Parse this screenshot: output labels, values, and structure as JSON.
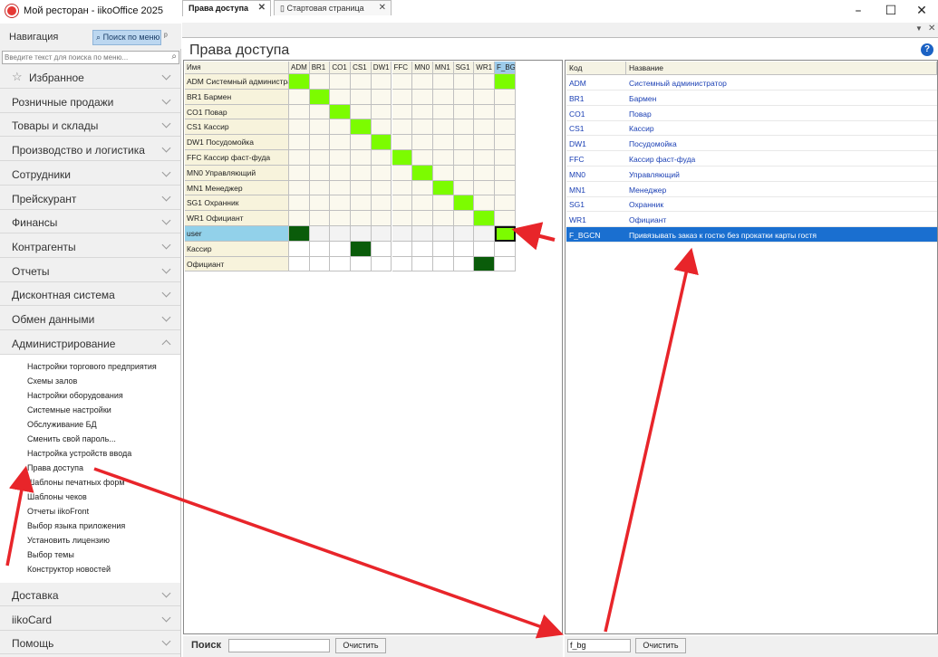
{
  "window": {
    "title": "Мой ресторан - iikoOffice 2025",
    "minimize": "–",
    "maximize": "☐",
    "close": "✕"
  },
  "nav": {
    "title": "Навигация",
    "search_button": "Поиск по меню",
    "search_placeholder": "Введите текст для поиска по меню...",
    "favorites": "Избранное",
    "sections_top": [
      "Розничные продажи",
      "Товары и склады",
      "Производство и логистика",
      "Сотрудники",
      "Прейскурант",
      "Финансы",
      "Контрагенты",
      "Отчеты",
      "Дисконтная система",
      "Обмен данными",
      "Администрирование"
    ],
    "admin_items": [
      "Настройки торгового предприятия",
      "Схемы залов",
      "Настройки оборудования",
      "Системные настройки",
      "Обслуживание БД",
      "Сменить свой пароль...",
      "Настройка устройств ввода",
      "Права доступа",
      "Шаблоны печатных форм",
      "Шаблоны чеков",
      "Отчеты iikoFront",
      "Выбор языка приложения",
      "Установить лицензию",
      "Выбор темы",
      "Конструктор новостей"
    ],
    "sections_bottom": [
      "Доставка",
      "iikoCard",
      "Помощь"
    ]
  },
  "tabs": [
    {
      "label": "Права доступа",
      "active": true
    },
    {
      "label": "Стартовая страница",
      "active": false
    }
  ],
  "page_title": "Права доступа",
  "matrix": {
    "name_header": "Имя",
    "columns": [
      "ADM",
      "BR1",
      "CO1",
      "CS1",
      "DW1",
      "FFC",
      "MN0",
      "MN1",
      "SG1",
      "WR1",
      "F_BGCN"
    ],
    "selected_column": 10,
    "rows": [
      {
        "name": "ADM Системный администратор",
        "on": [
          0,
          10
        ],
        "dark": []
      },
      {
        "name": "BR1 Бармен",
        "on": [
          1
        ],
        "dark": []
      },
      {
        "name": "CO1 Повар",
        "on": [
          2
        ],
        "dark": []
      },
      {
        "name": "CS1 Кассир",
        "on": [
          3
        ],
        "dark": []
      },
      {
        "name": "DW1 Посудомойка",
        "on": [
          4
        ],
        "dark": []
      },
      {
        "name": "FFC Кассир фаст-фуда",
        "on": [
          5
        ],
        "dark": []
      },
      {
        "name": "MN0 Управляющий",
        "on": [
          6
        ],
        "dark": []
      },
      {
        "name": "MN1 Менеджер",
        "on": [
          7
        ],
        "dark": []
      },
      {
        "name": "SG1 Охранник",
        "on": [
          8
        ],
        "dark": []
      },
      {
        "name": "WR1 Официант",
        "on": [
          9
        ],
        "dark": []
      },
      {
        "name": "user",
        "on": [
          10
        ],
        "dark": [
          0
        ],
        "selected": true,
        "focus_col": 10
      },
      {
        "name": "Кассир",
        "on": [],
        "dark": [
          3
        ]
      },
      {
        "name": "Официант",
        "on": [],
        "dark": [
          9
        ]
      }
    ],
    "on_color": "#7cfc00",
    "dark_color": "#0a5c0a"
  },
  "codes": {
    "code_header": "Код",
    "name_header": "Название",
    "rows": [
      {
        "code": "ADM",
        "name": "Системный администратор"
      },
      {
        "code": "BR1",
        "name": "Бармен"
      },
      {
        "code": "CO1",
        "name": "Повар"
      },
      {
        "code": "CS1",
        "name": "Кассир"
      },
      {
        "code": "DW1",
        "name": "Посудомойка"
      },
      {
        "code": "FFC",
        "name": "Кассир фаст-фуда"
      },
      {
        "code": "MN0",
        "name": "Управляющий"
      },
      {
        "code": "MN1",
        "name": "Менеджер"
      },
      {
        "code": "SG1",
        "name": "Охранник"
      },
      {
        "code": "WR1",
        "name": "Официант"
      },
      {
        "code": "F_BGCN",
        "name": "Привязывать заказ к гостю без прокатки карты гостя",
        "selected": true
      }
    ]
  },
  "bottom": {
    "search_label": "Поиск",
    "search_value": "",
    "clear_label": "Очистить",
    "code_filter_value": "f_bg",
    "clear_right_label": "Очистить"
  },
  "colors": {
    "accent": "#1a6fd0",
    "arrow": "#e8252a"
  }
}
